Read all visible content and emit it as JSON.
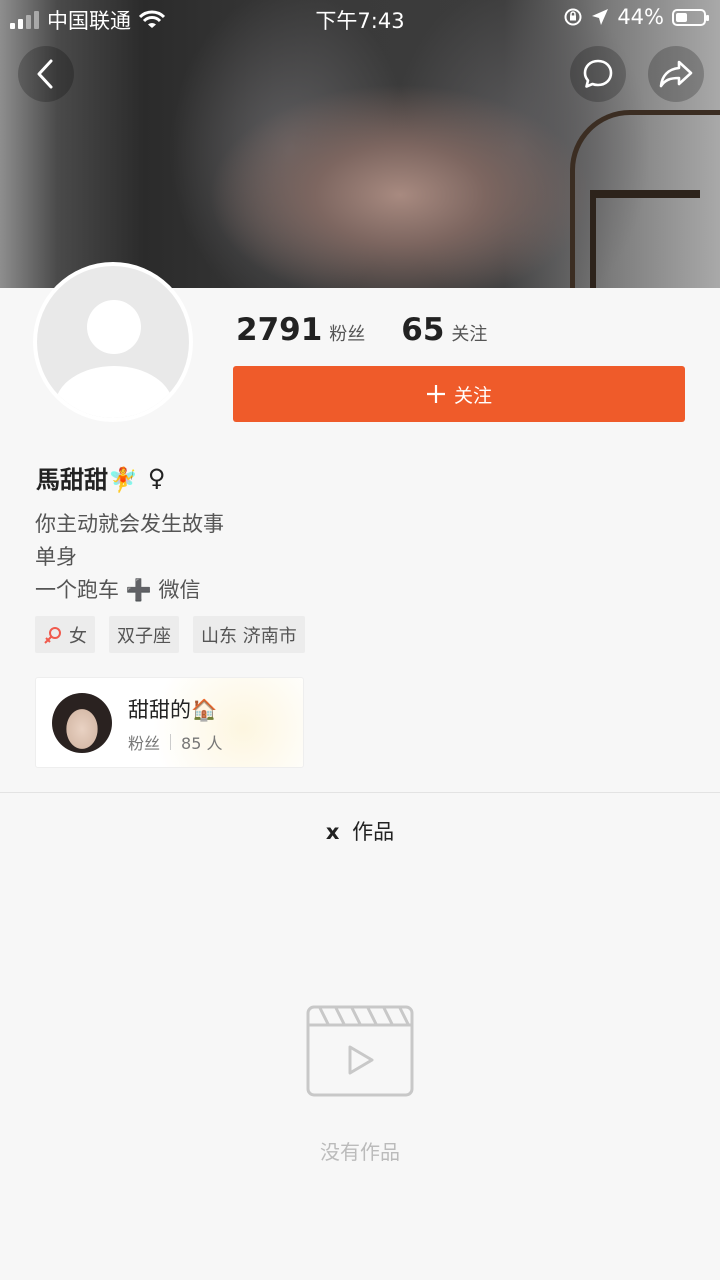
{
  "status_bar": {
    "carrier": "中国联通",
    "time": "下午7:43",
    "battery": "44%",
    "battery_level": 0.44
  },
  "profile": {
    "followers_count": "2791",
    "followers_label": "粉丝",
    "following_count": "65",
    "following_label": "关注",
    "follow_button_label": "关注",
    "name": "馬甜甜🧚",
    "gender_symbol": "♀",
    "bio_lines": [
      "你主动就会发生故事",
      "单身",
      "一个跑车 ➕ 微信"
    ],
    "tags": [
      "女",
      "双子座",
      "山东 济南市"
    ]
  },
  "group": {
    "title": "甜甜的🏠",
    "fans_label": "粉丝",
    "fans_count": "85 人"
  },
  "works": {
    "tab_prefix": "x",
    "tab_label": "作品",
    "empty_text": "没有作品"
  },
  "colors": {
    "accent": "#ef5b2a",
    "female": "#f05a4d"
  },
  "icons": {
    "back": "chevron-left-icon",
    "message": "chat-bubble-icon",
    "share": "share-arrow-icon",
    "empty": "video-clapper-icon"
  }
}
